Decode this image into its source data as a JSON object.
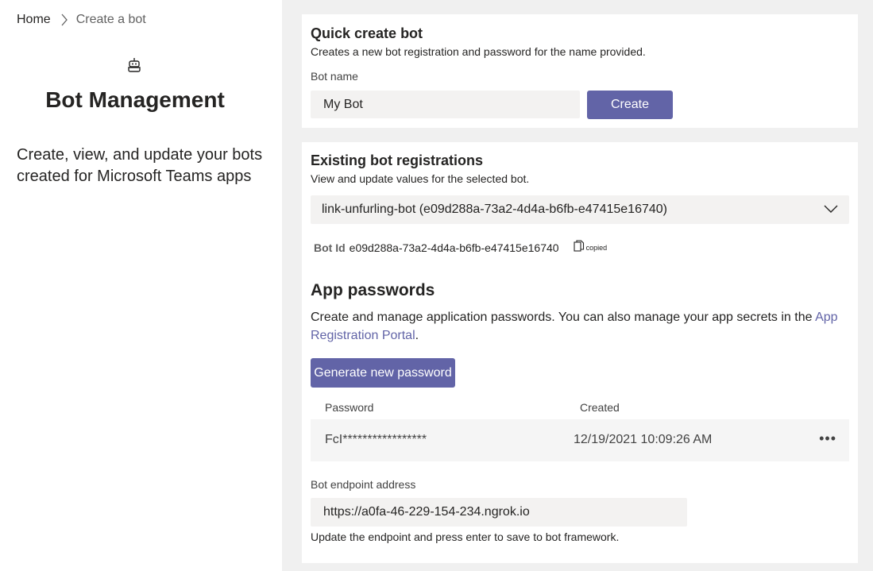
{
  "breadcrumb": {
    "home": "Home",
    "current": "Create a bot"
  },
  "left": {
    "icon": "bot-icon",
    "title": "Bot Management",
    "description": "Create, view, and update your bots created for Microsoft Teams apps"
  },
  "quick_create": {
    "title": "Quick create bot",
    "subtitle": "Creates a new bot registration and password for the name provided.",
    "field_label": "Bot name",
    "field_value": "My Bot",
    "button_label": "Create"
  },
  "existing": {
    "title": "Existing bot registrations",
    "subtitle": "View and update values for the selected bot.",
    "selected_bot": "link-unfurling-bot (e09d288a-73a2-4d4a-b6fb-e47415e16740)",
    "bot_id_label": "Bot Id",
    "bot_id_value": "e09d288a-73a2-4d4a-b6fb-e47415e16740",
    "copied_label": "copied"
  },
  "passwords": {
    "title": "App passwords",
    "description_prefix": "Create and manage application passwords. You can also manage your app secrets in the ",
    "link_text": "App Registration Portal",
    "description_suffix": ".",
    "generate_button": "Generate new password",
    "columns": [
      "Password",
      "Created"
    ],
    "rows": [
      {
        "password": "FcI*****************",
        "created": "12/19/2021 10:09:26 AM",
        "more": "•••"
      }
    ]
  },
  "endpoint": {
    "label": "Bot endpoint address",
    "value": "https://a0fa-46-229-154-234.ngrok.io",
    "hint": "Update the endpoint and press enter to save to bot framework."
  },
  "colors": {
    "accent": "#6264a7",
    "background": "#f0f0f0",
    "input": "#f3f2f1"
  }
}
